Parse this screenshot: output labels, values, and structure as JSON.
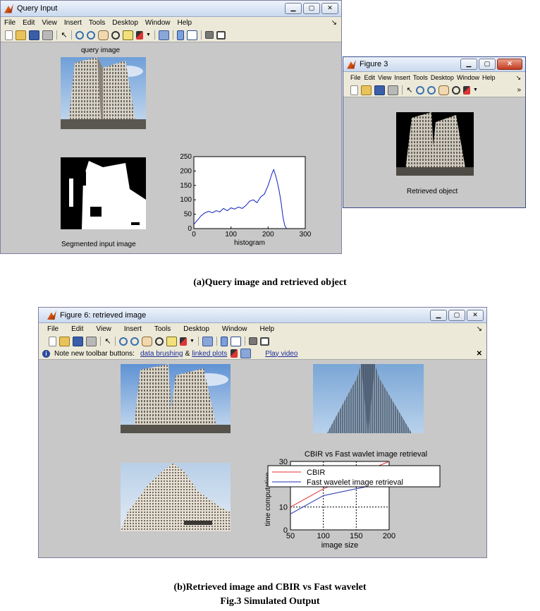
{
  "win1": {
    "title": "Query Input",
    "menu": [
      "File",
      "Edit",
      "View",
      "Insert",
      "Tools",
      "Desktop",
      "Window",
      "Help"
    ],
    "query_label": "query image",
    "segmented_label": "Segmented input image",
    "histogram": {
      "xlabel": "histogram",
      "xticks": [
        "0",
        "100",
        "200",
        "300"
      ],
      "yticks": [
        "0",
        "50",
        "100",
        "150",
        "200",
        "250"
      ]
    }
  },
  "win2": {
    "title": "Figure 3",
    "menu": [
      "File",
      "Edit",
      "View",
      "Insert",
      "Tools",
      "Desktop",
      "Window",
      "Help"
    ],
    "retrieved_label": "Retrieved object"
  },
  "win3": {
    "title": "Figure 6: retrieved image",
    "menu": [
      "File",
      "Edit",
      "View",
      "Insert",
      "Tools",
      "Desktop",
      "Window",
      "Help"
    ],
    "note": {
      "prefix": "Note new toolbar buttons:",
      "link1": "data brushing",
      "amp": "&",
      "link2": "linked plots",
      "link3": "Play video"
    }
  },
  "chart_data": [
    {
      "type": "line",
      "title": "",
      "xlabel": "histogram",
      "ylabel": "",
      "xlim": [
        0,
        300
      ],
      "ylim": [
        0,
        250
      ],
      "grid": false,
      "series": [
        {
          "x": [
            0,
            10,
            20,
            30,
            40,
            50,
            60,
            70,
            80,
            90,
            100,
            110,
            120,
            130,
            140,
            150,
            160,
            170,
            180,
            190,
            200,
            205,
            210,
            215,
            220,
            225,
            230,
            235,
            240,
            245,
            250
          ],
          "y": [
            15,
            30,
            45,
            55,
            60,
            55,
            62,
            58,
            70,
            62,
            72,
            68,
            75,
            70,
            80,
            95,
            100,
            90,
            110,
            120,
            150,
            170,
            190,
            205,
            185,
            160,
            130,
            90,
            40,
            10,
            0
          ]
        }
      ]
    },
    {
      "type": "line",
      "title": "CBIR vs Fast wavlet image retrieval",
      "xlabel": "image size",
      "ylabel": "time computation",
      "xlim": [
        50,
        200
      ],
      "ylim": [
        0,
        30
      ],
      "xticks": [
        "50",
        "100",
        "150",
        "200"
      ],
      "yticks": [
        "0",
        "10",
        "20",
        "30"
      ],
      "grid": true,
      "legend": "top-left",
      "series": [
        {
          "name": "CBIR",
          "color": "#e03030",
          "x": [
            50,
            100,
            150,
            200
          ],
          "y": [
            10,
            18,
            24,
            30
          ]
        },
        {
          "name": "Fast wavelet image retrieval",
          "color": "#2030b0",
          "x": [
            50,
            100,
            150,
            200
          ],
          "y": [
            7,
            15,
            18,
            21
          ]
        }
      ]
    }
  ],
  "captions": {
    "a": "(a)Query image and retrieved object",
    "b": "(b)Retrieved image and CBIR vs Fast wavelet",
    "fig": "Fig.3 Simulated Output"
  }
}
